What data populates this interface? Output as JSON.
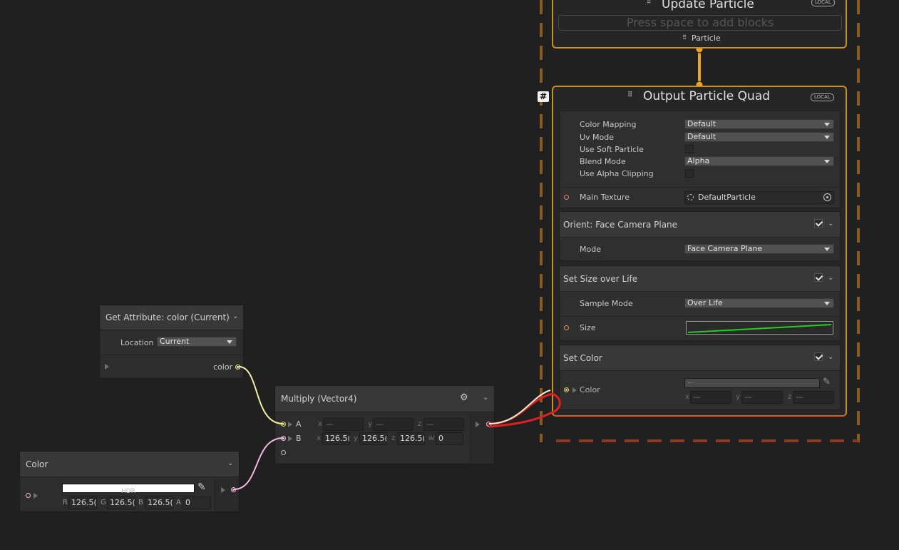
{
  "update_context": {
    "title": "Update Particle",
    "local_badge": "LOCAL",
    "placeholder": "Press space to add blocks",
    "flow_label": "Particle"
  },
  "output_context": {
    "title": "Output Particle Quad",
    "local_badge": "LOCAL",
    "hash_badge": "#",
    "settings": [
      {
        "label": "Color Mapping",
        "type": "dropdown",
        "value": "Default"
      },
      {
        "label": "Uv Mode",
        "type": "dropdown",
        "value": "Default"
      },
      {
        "label": "Use Soft Particle",
        "type": "checkbox",
        "checked": false
      },
      {
        "label": "Blend Mode",
        "type": "dropdown",
        "value": "Alpha"
      },
      {
        "label": "Use Alpha Clipping",
        "type": "checkbox",
        "checked": false
      }
    ],
    "main_texture": {
      "label": "Main Texture",
      "value": "DefaultParticle"
    },
    "blocks": {
      "orient": {
        "title": "Orient: Face Camera Plane",
        "enabled": true,
        "mode_label": "Mode",
        "mode_value": "Face Camera Plane"
      },
      "size": {
        "title": "Set Size over Life",
        "enabled": true,
        "sample_label": "Sample Mode",
        "sample_value": "Over Life",
        "size_label": "Size"
      },
      "color": {
        "title": "Set Color",
        "enabled": true,
        "color_label": "Color",
        "dash": "—",
        "x_label": "x",
        "x_value": "—",
        "y_label": "y",
        "y_value": "—",
        "z_label": "z",
        "z_value": "—"
      }
    }
  },
  "get_attribute_node": {
    "title": "Get Attribute: color (Current)",
    "location_label": "Location",
    "location_value": "Current",
    "output_label": "color"
  },
  "multiply_node": {
    "title": "Multiply (Vector4)",
    "a_label": "A",
    "b_label": "B",
    "a": {
      "x_label": "x",
      "x": "—",
      "y_label": "y",
      "y": "—",
      "z_label": "z",
      "z": "—"
    },
    "b": {
      "x_label": "x",
      "x": "126.5(",
      "y_label": "y",
      "y": "126.5(",
      "z_label": "z",
      "z": "126.5(",
      "w_label": "w",
      "w": "0"
    }
  },
  "color_node": {
    "title": "Color",
    "hdr_label": "HDR",
    "r_label": "R",
    "r": "126.5(",
    "g_label": "G",
    "g": "126.5(",
    "b_label": "B",
    "b": "126.5(",
    "a_label": "A",
    "a": "0"
  },
  "colors": {
    "background": "#202020",
    "update_border": "#c8902a",
    "output_border": "#c8902a",
    "output_bottom_border": "#d06030",
    "dash_orange": "#8a5a1e",
    "dash_red": "#8c3a26",
    "wire_yellow": "#f2f0a0",
    "wire_pink": "#f2b8e0",
    "wire_red": "#e02020"
  }
}
